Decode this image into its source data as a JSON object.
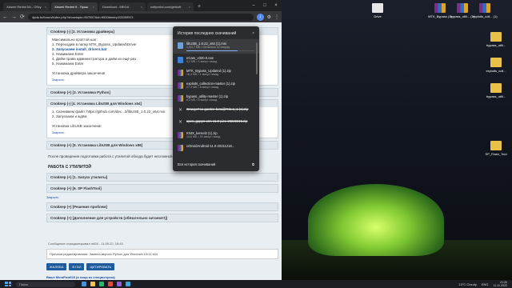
{
  "browser": {
    "tabs": [
      {
        "label": "Xiaomi Redmi 5A - Обсу",
        "active": false
      },
      {
        "label": "Xiaomi Redmi 5 - Прош",
        "active": true
      },
      {
        "label": "Download - MEGA",
        "active": false
      },
      {
        "label": "softportal.com/getsoft",
        "active": false
      }
    ],
    "url": "4pda.to/forum/index.php?showtopic=907057&st=9000#entry103359971"
  },
  "forum": {
    "spoiler1_title": "Спойлер (-) [2. Установка драйвера]",
    "spoiler1_lines": [
      "Максимально простой шаг:",
      "1. Переходим в папку MTK_Bypass_Updated\\Driver",
      "2. Запускаем install_drivers.bat",
      "3. Нажимаем Enter",
      "4. Даём права администратора и даём из ещё раз",
      "5. Нажимаем Enter"
    ],
    "spoiler1_done": "Установка драйвера закончена!",
    "close": "Закрыть",
    "spoiler2_title": "Спойлер (+) [3. Установка Python]",
    "spoiler3_title": "Спойлер (-) [4. Установка LibUSB для Windows x64]",
    "spoiler3_lines": [
      "1. Скачиваем файл: https://github.com/dec...2/libUSB_1.0.22_x64.msi",
      "2. Запускаем и ждём"
    ],
    "spoiler3_done": "Установка LibUSB закончена!",
    "spoiler4_title": "Спойлер (+) [5. Установка LibUSB для Windows x86]",
    "after_text": "После проведения подготовки работа с утилитой обхода будет несложной.",
    "section_title": "РАБОТА С УТИЛИТОЙ",
    "spoiler5_title": "Спойлер (+) [1. Запуск утилиты]",
    "spoiler6_title": "Спойлер (+) [6. SP FlashTool]",
    "spoiler7_title": "Спойлер (+) [Решение проблем]",
    "spoiler8_title": "Спойлер (+) [Дополнение для устройств (обязательно читаем!!!)]",
    "post_info": "Сообщение отредактировал mf28 - 11.09.22, 18:43",
    "edit_reason": "Причина редактирования: Замена версии Python для Windows 10/11 x64",
    "footer_buttons": [
      "ЖАЛОБА",
      "В ГАЛ",
      "ЦИТИРОВАТЬ"
    ],
    "mp_link": "Ваше МегаРом028 (и лица из спецвыпуска)"
  },
  "downloads": {
    "title": "История последних скачиваний",
    "items": [
      {
        "name": "libUSB_1.0.22_x64 (1).msi",
        "meta": "1,3/1,7 МБ • Осталось 14 секунд",
        "icon": "msi-file-icon",
        "progress": 0.75
      },
      {
        "name": "eCam_v320.0.exe",
        "meta": "9,2 МБ • 4 минут назад",
        "icon": "exe-file-icon"
      },
      {
        "name": "MTK_Bypass_Updated (1).zip",
        "meta": "16,4 МБ • 1 минут назад",
        "icon": "zip-file-icon"
      },
      {
        "name": "exploits_collection-master (1).zip",
        "meta": "27,4 МБ • 8 минут назад",
        "icon": "zip-file-icon"
      },
      {
        "name": "bypass_utility-master (1).zip",
        "meta": "6,3 МБ • 8 минут назад",
        "icon": "zip-file-icon"
      },
      {
        "name": "OrangeFox-garden-beta@R11.1_1 (1).zip",
        "meta": "",
        "icon": "cancelled-icon",
        "cancelled": true
      },
      {
        "name": "open_gapps-arm-11.0-pico-20220215.zip",
        "meta": "",
        "icon": "cancelled-icon",
        "cancelled": true
      },
      {
        "name": "KNIX_kernel2 (1).zip",
        "meta": "14,6 МБ • 30 минут назад",
        "icon": "zip-file-icon"
      },
      {
        "name": "crDroidAndroid-11.0-20211216...",
        "meta": "",
        "icon": "zip-file-icon"
      }
    ],
    "all_label": "Вся история скачиваний"
  },
  "desktop": {
    "icons": [
      "Drive",
      "MTK_Bypass (1)",
      "bypass_utili... (1)",
      "exploits_coll... (1)",
      "bypass_utili...",
      "exploits_coll...",
      "bypass_utili...",
      "SP_Flash_Tool"
    ]
  },
  "taskbar": {
    "search_placeholder": "Поиск",
    "weather": "13°C Cloudy",
    "time": "21:30",
    "date": "11.11.2022",
    "lang": "ENG"
  }
}
